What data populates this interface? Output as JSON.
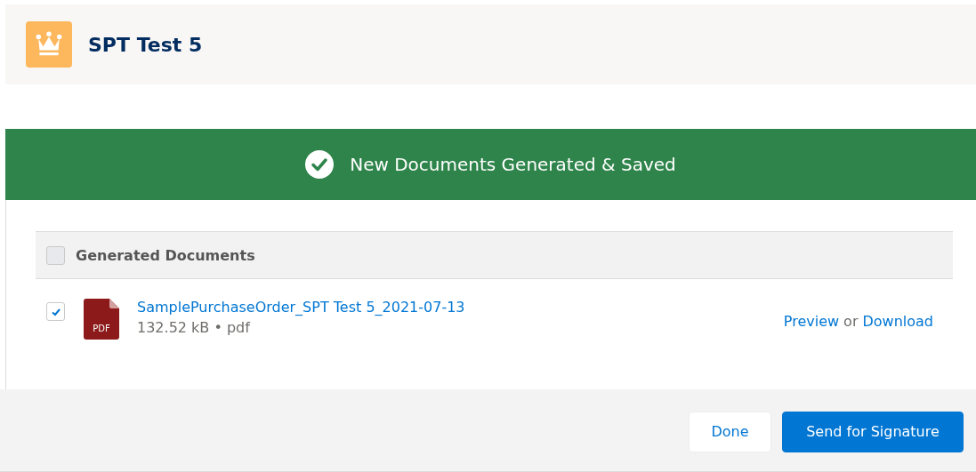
{
  "header": {
    "title": "SPT Test 5"
  },
  "banner": {
    "message": "New Documents Generated & Saved"
  },
  "table": {
    "header": {
      "label": "Generated Documents",
      "checked": false
    },
    "rows": [
      {
        "name": "SamplePurchaseOrder_SPT Test 5_2021-07-13",
        "meta": "132.52 kB • pdf",
        "file_badge": "PDF",
        "checked": true,
        "preview": "Preview",
        "separator": "or",
        "download": "Download"
      }
    ]
  },
  "footer": {
    "buttons": [
      {
        "label": "Done",
        "kind": "neutral"
      },
      {
        "label": "Send for Signature",
        "kind": "brand"
      }
    ]
  }
}
